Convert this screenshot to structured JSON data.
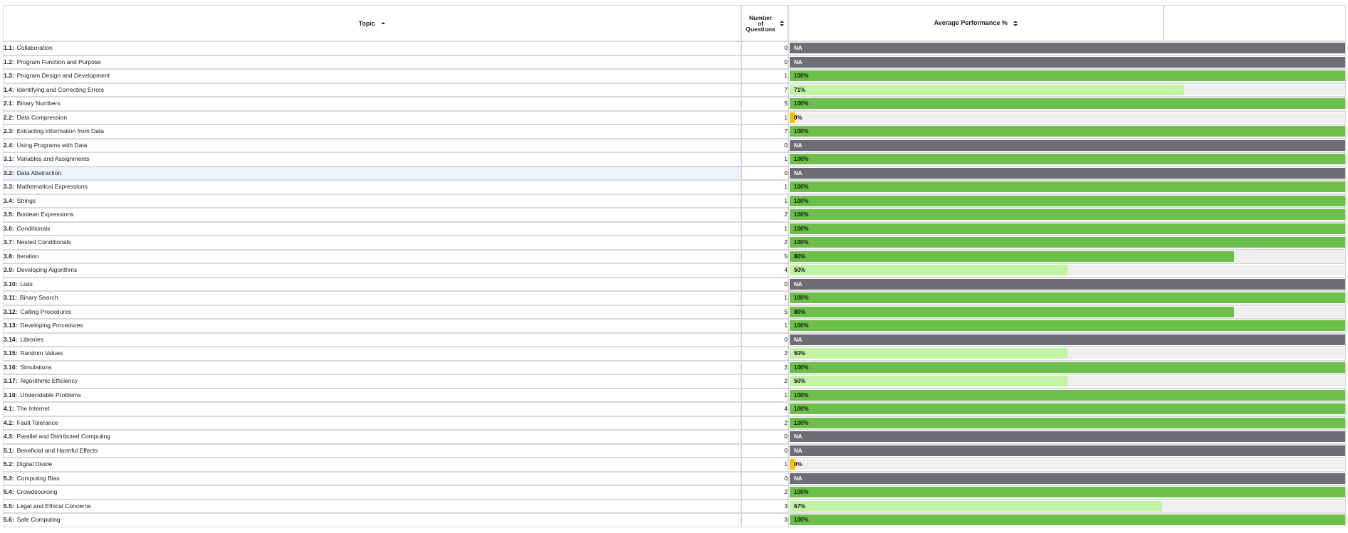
{
  "header": {
    "topic_label": "Topic",
    "num_label_lines": [
      "Number",
      "of",
      "Questions"
    ],
    "perf_label": "Average Performance %"
  },
  "colors": {
    "full": "#6cbf4a",
    "partial": "#c3f3a4",
    "zero": "#f2c200",
    "na": "#6d6d76",
    "track": "#efefef"
  },
  "rows": [
    {
      "code": "1.1:",
      "name": "Collaboration",
      "count": "0",
      "perf": "NA",
      "value": null
    },
    {
      "code": "1.2:",
      "name": "Program Function and Purpose",
      "count": "0",
      "perf": "NA",
      "value": null
    },
    {
      "code": "1.3:",
      "name": "Program Design and Development",
      "count": "1",
      "perf": "100%",
      "value": 100
    },
    {
      "code": "1.4:",
      "name": "Identifying and Correcting Errors",
      "count": "7",
      "perf": "71%",
      "value": 71
    },
    {
      "code": "2.1:",
      "name": "Binary Numbers",
      "count": "5",
      "perf": "100%",
      "value": 100
    },
    {
      "code": "2.2:",
      "name": "Data Compression",
      "count": "1",
      "perf": "0%",
      "value": 0
    },
    {
      "code": "2.3:",
      "name": "Extracting Information from Data",
      "count": "7",
      "perf": "100%",
      "value": 100
    },
    {
      "code": "2.4:",
      "name": "Using Programs with Data",
      "count": "0",
      "perf": "NA",
      "value": null
    },
    {
      "code": "3.1:",
      "name": "Variables and Assignments",
      "count": "1",
      "perf": "100%",
      "value": 100
    },
    {
      "code": "3.2:",
      "name": "Data Abstraction",
      "count": "0",
      "perf": "NA",
      "value": null
    },
    {
      "code": "3.3:",
      "name": "Mathematical Expressions",
      "count": "1",
      "perf": "100%",
      "value": 100
    },
    {
      "code": "3.4:",
      "name": "Strings",
      "count": "1",
      "perf": "100%",
      "value": 100
    },
    {
      "code": "3.5:",
      "name": "Boolean Expressions",
      "count": "2",
      "perf": "100%",
      "value": 100
    },
    {
      "code": "3.6:",
      "name": "Conditionals",
      "count": "1",
      "perf": "100%",
      "value": 100
    },
    {
      "code": "3.7:",
      "name": "Nested Conditionals",
      "count": "2",
      "perf": "100%",
      "value": 100
    },
    {
      "code": "3.8:",
      "name": "Iteration",
      "count": "5",
      "perf": "80%",
      "value": 80
    },
    {
      "code": "3.9:",
      "name": "Developing Algorithms",
      "count": "4",
      "perf": "50%",
      "value": 50
    },
    {
      "code": "3.10:",
      "name": "Lists",
      "count": "0",
      "perf": "NA",
      "value": null
    },
    {
      "code": "3.11:",
      "name": "Binary Search",
      "count": "1",
      "perf": "100%",
      "value": 100
    },
    {
      "code": "3.12:",
      "name": "Calling Procedures",
      "count": "5",
      "perf": "80%",
      "value": 80
    },
    {
      "code": "3.13:",
      "name": "Developing Procedures",
      "count": "1",
      "perf": "100%",
      "value": 100
    },
    {
      "code": "3.14:",
      "name": "Libraries",
      "count": "0",
      "perf": "NA",
      "value": null
    },
    {
      "code": "3.15:",
      "name": "Random Values",
      "count": "2",
      "perf": "50%",
      "value": 50
    },
    {
      "code": "3.16:",
      "name": "Simulations",
      "count": "2",
      "perf": "100%",
      "value": 100
    },
    {
      "code": "3.17:",
      "name": "Algorithmic Efficiency",
      "count": "2",
      "perf": "50%",
      "value": 50
    },
    {
      "code": "3.18:",
      "name": "Undecidable Problems",
      "count": "1",
      "perf": "100%",
      "value": 100
    },
    {
      "code": "4.1:",
      "name": "The Internet",
      "count": "4",
      "perf": "100%",
      "value": 100
    },
    {
      "code": "4.2:",
      "name": "Fault Tolerance",
      "count": "2",
      "perf": "100%",
      "value": 100
    },
    {
      "code": "4.3:",
      "name": "Parallel and Distributed Computing",
      "count": "0",
      "perf": "NA",
      "value": null
    },
    {
      "code": "5.1:",
      "name": "Beneficial and Harmful Effects",
      "count": "0",
      "perf": "NA",
      "value": null
    },
    {
      "code": "5.2:",
      "name": "Digital Divide",
      "count": "1",
      "perf": "0%",
      "value": 0
    },
    {
      "code": "5.3:",
      "name": "Computing Bias",
      "count": "0",
      "perf": "NA",
      "value": null
    },
    {
      "code": "5.4:",
      "name": "Crowdsourcing",
      "count": "2",
      "perf": "100%",
      "value": 100
    },
    {
      "code": "5.5:",
      "name": "Legal and Ethical Concerns",
      "count": "3",
      "perf": "67%",
      "value": 67
    },
    {
      "code": "5.6:",
      "name": "Safe Computing",
      "count": "3",
      "perf": "100%",
      "value": 100
    }
  ],
  "highlighted_row": 9
}
